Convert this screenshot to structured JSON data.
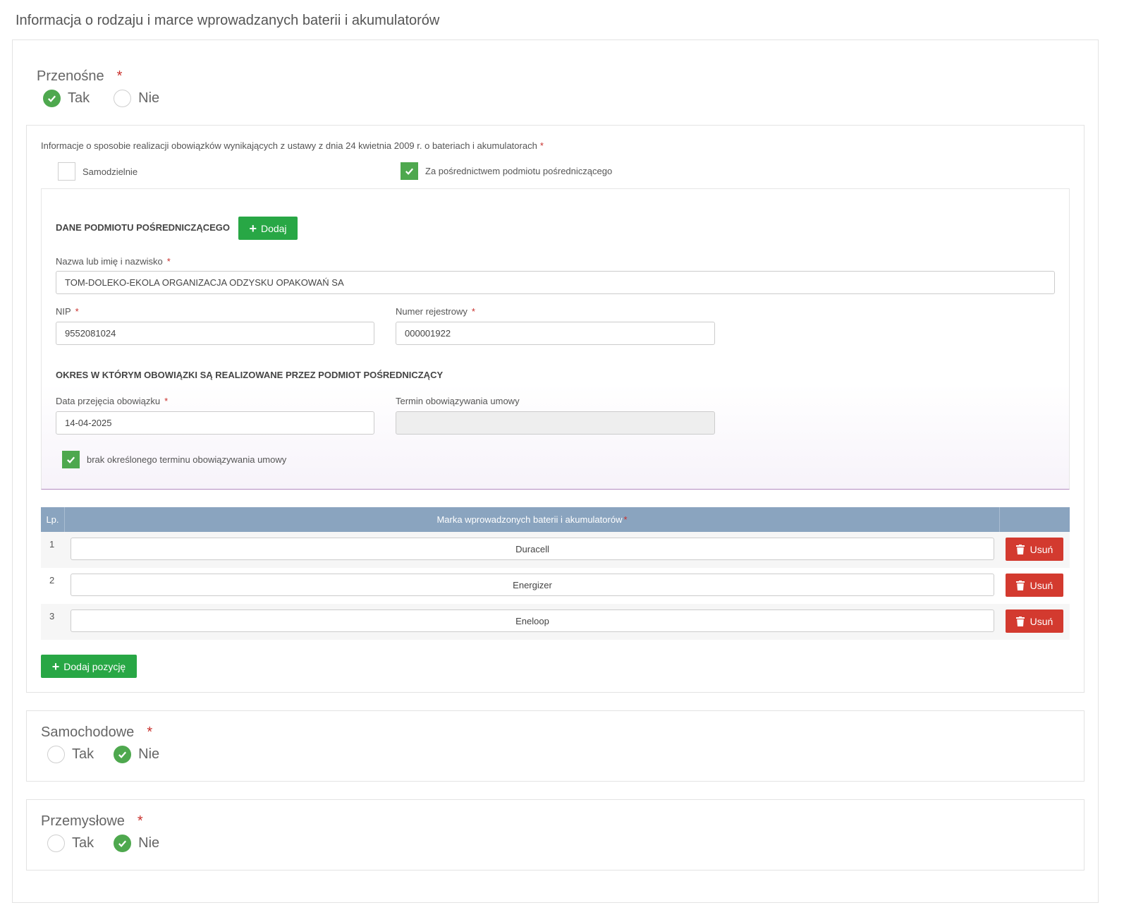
{
  "page_title": "Informacja o rodzaju i marce wprowadzanych baterii i akumulatorów",
  "required_mark": "*",
  "przenosne": {
    "label": "Przenośne",
    "options": [
      "Tak",
      "Nie"
    ],
    "selected": "Tak"
  },
  "obligations": {
    "label": "Informacje o sposobie realizacji obowiązków wynikających z ustawy z dnia 24 kwietnia 2009 r. o bateriach i akumulatorach",
    "samodzielnie": {
      "label": "Samodzielnie",
      "checked": false
    },
    "posrednictwo": {
      "label": "Za pośrednictwem podmiotu pośredniczącego",
      "checked": true
    }
  },
  "intermediary": {
    "section_title": "DANE PODMIOTU POŚREDNICZĄCEGO",
    "add_label": "Dodaj",
    "name_label": "Nazwa lub imię i nazwisko",
    "name_value": "TOM-DOLEKO-EKOLA ORGANIZACJA ODZYSKU OPAKOWAŃ SA",
    "nip_label": "NIP",
    "nip_value": "9552081024",
    "reg_label": "Numer rejestrowy",
    "reg_value": "000001922",
    "period_title": "OKRES W KTÓRYM OBOWIĄZKI SĄ REALIZOWANE PRZEZ PODMIOT POŚREDNICZĄCY",
    "date_label": "Data przejęcia obowiązku",
    "date_value": "14-04-2025",
    "term_label": "Termin obowiązywania umowy",
    "term_value": "",
    "no_term_label": "brak określonego terminu obowiązywania umowy",
    "no_term_checked": true
  },
  "brands_table": {
    "col_lp": "Lp.",
    "col_brand": "Marka wprowadzonych baterii i akumulatorów",
    "rows": [
      {
        "lp": "1",
        "brand": "Duracell"
      },
      {
        "lp": "2",
        "brand": "Energizer"
      },
      {
        "lp": "3",
        "brand": "Eneloop"
      }
    ],
    "remove_label": "Usuń",
    "add_position_label": "Dodaj pozycję"
  },
  "samochodowe": {
    "label": "Samochodowe",
    "options": [
      "Tak",
      "Nie"
    ],
    "selected": "Nie"
  },
  "przemyslowe": {
    "label": "Przemysłowe",
    "options": [
      "Tak",
      "Nie"
    ],
    "selected": "Nie"
  },
  "colors": {
    "green": "#28a745",
    "check_green": "#4ea84e",
    "red": "#d33a2f",
    "table_header": "#8aa4bf"
  }
}
